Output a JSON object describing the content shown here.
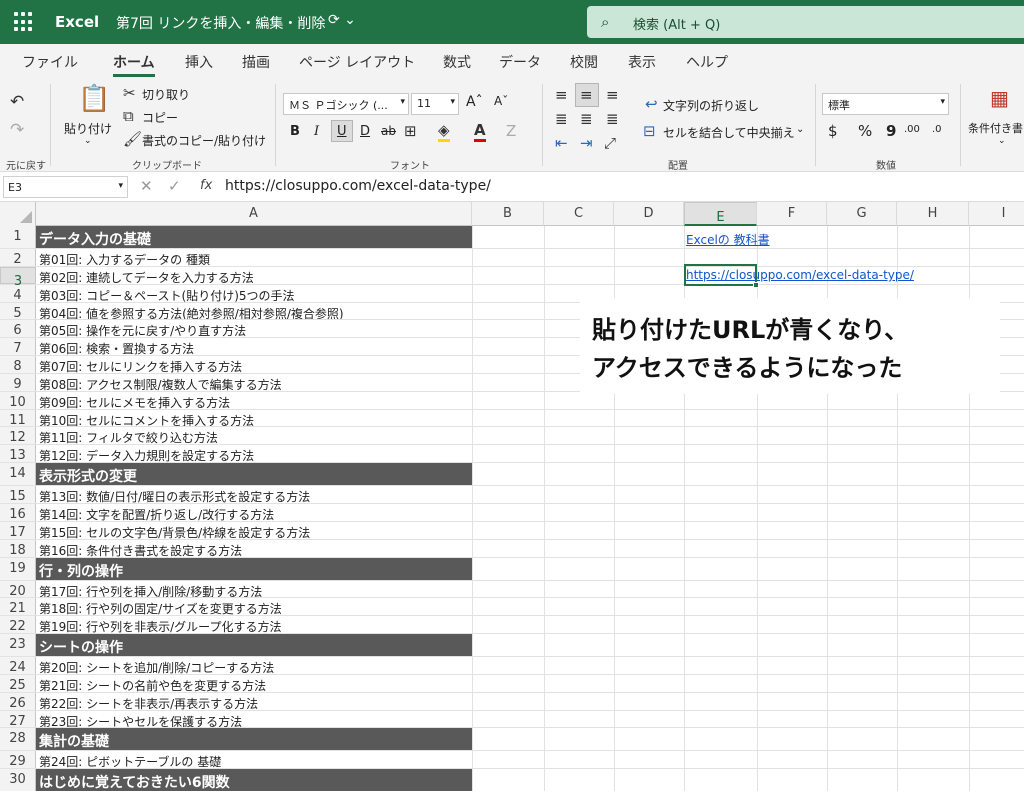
{
  "titlebar": {
    "app_name": "Excel",
    "doc_title": "第7回 リンクを挿入・編集・削除",
    "doc_icons": "⟳ ⌄",
    "search_placeholder": "検索 (Alt + Q)",
    "accent_color": "#217346"
  },
  "tabs": [
    "ファイル",
    "ホーム",
    "挿入",
    "描画",
    "ページ レイアウト",
    "数式",
    "データ",
    "校閲",
    "表示",
    "ヘルプ"
  ],
  "active_tab": "ホーム",
  "ribbon": {
    "undo_group_label": "元に戻す",
    "clipboard": {
      "paste_label": "貼り付け",
      "cut_label": "切り取り",
      "copy_label": "コピー",
      "format_painter_label": "書式のコピー/貼り付け",
      "group_label": "クリップボード"
    },
    "font": {
      "font_name": "ＭＳ Ｐゴシック (...",
      "font_size": "11",
      "grow_font": "Aˆ",
      "shrink_font": "Aˇ",
      "bold": "B",
      "italic": "I",
      "underline": "U",
      "double_underline": "D",
      "strikethrough": "ab",
      "group_label": "フォント"
    },
    "alignment": {
      "wrap_text_label": "文字列の折り返し",
      "merge_center_label": "セルを結合して中央揃え",
      "group_label": "配置"
    },
    "number": {
      "format": "標準",
      "currency": "$",
      "percent": "%",
      "comma": "9",
      "inc_decimal": ".00",
      "dec_decimal": ".0",
      "group_label": "数値"
    },
    "conditional_label": "条件付き書"
  },
  "formula_bar": {
    "name_box": "E3",
    "fx": "fx",
    "content": "https://closuppo.com/excel-data-type/"
  },
  "columns": [
    "A",
    "B",
    "C",
    "D",
    "E",
    "F",
    "G",
    "H",
    "I"
  ],
  "selected_column": "E",
  "selected_row": "3",
  "rows": [
    {
      "n": "1",
      "a": "データ入力の基礎",
      "head": true
    },
    {
      "n": "2",
      "a": "第01回: 入力するデータの 種類",
      "head": false
    },
    {
      "n": "3",
      "a": "第02回: 連続してデータを入力する方法",
      "head": false
    },
    {
      "n": "4",
      "a": "第03回: コピー＆ペースト(貼り付け)5つの手法",
      "head": false
    },
    {
      "n": "5",
      "a": "第04回: 値を参照する方法(絶対参照/相対参照/複合参照)",
      "head": false
    },
    {
      "n": "6",
      "a": "第05回: 操作を元に戻す/やり直す方法",
      "head": false
    },
    {
      "n": "7",
      "a": "第06回: 検索・置換する方法",
      "head": false
    },
    {
      "n": "8",
      "a": "第07回: セルにリンクを挿入する方法",
      "head": false
    },
    {
      "n": "9",
      "a": "第08回: アクセス制限/複数人で編集する方法",
      "head": false
    },
    {
      "n": "10",
      "a": "第09回: セルにメモを挿入する方法",
      "head": false
    },
    {
      "n": "11",
      "a": "第10回: セルにコメントを挿入する方法",
      "head": false
    },
    {
      "n": "12",
      "a": "第11回: フィルタで絞り込む方法",
      "head": false
    },
    {
      "n": "13",
      "a": "第12回: データ入力規則を設定する方法",
      "head": false
    },
    {
      "n": "14",
      "a": "表示形式の変更",
      "head": true
    },
    {
      "n": "15",
      "a": "第13回: 数値/日付/曜日の表示形式を設定する方法",
      "head": false
    },
    {
      "n": "16",
      "a": "第14回: 文字を配置/折り返し/改行する方法",
      "head": false
    },
    {
      "n": "17",
      "a": "第15回: セルの文字色/背景色/枠線を設定する方法",
      "head": false
    },
    {
      "n": "18",
      "a": "第16回: 条件付き書式を設定する方法",
      "head": false
    },
    {
      "n": "19",
      "a": "行・列の操作",
      "head": true
    },
    {
      "n": "20",
      "a": "第17回: 行や列を挿入/削除/移動する方法",
      "head": false
    },
    {
      "n": "21",
      "a": "第18回: 行や列の固定/サイズを変更する方法",
      "head": false
    },
    {
      "n": "22",
      "a": "第19回: 行や列を非表示/グループ化する方法",
      "head": false
    },
    {
      "n": "23",
      "a": "シートの操作",
      "head": true
    },
    {
      "n": "24",
      "a": "第20回: シートを追加/削除/コピーする方法",
      "head": false
    },
    {
      "n": "25",
      "a": "第21回: シートの名前や色を変更する方法",
      "head": false
    },
    {
      "n": "26",
      "a": "第22回: シートを非表示/再表示する方法",
      "head": false
    },
    {
      "n": "27",
      "a": "第23回: シートやセルを保護する方法",
      "head": false
    },
    {
      "n": "28",
      "a": "集計の基礎",
      "head": true
    },
    {
      "n": "29",
      "a": "第24回: ピボットテーブルの 基礎",
      "head": false
    },
    {
      "n": "30",
      "a": "はじめに覚えておきたい6関数",
      "head": true
    }
  ],
  "cells": {
    "e1_link": "Excelの 教科書",
    "e3_link": "https://closuppo.com/excel-data-type/"
  },
  "callout": {
    "line1": "貼り付けたURLが青くなり、",
    "line2": "アクセスできるようになった"
  }
}
